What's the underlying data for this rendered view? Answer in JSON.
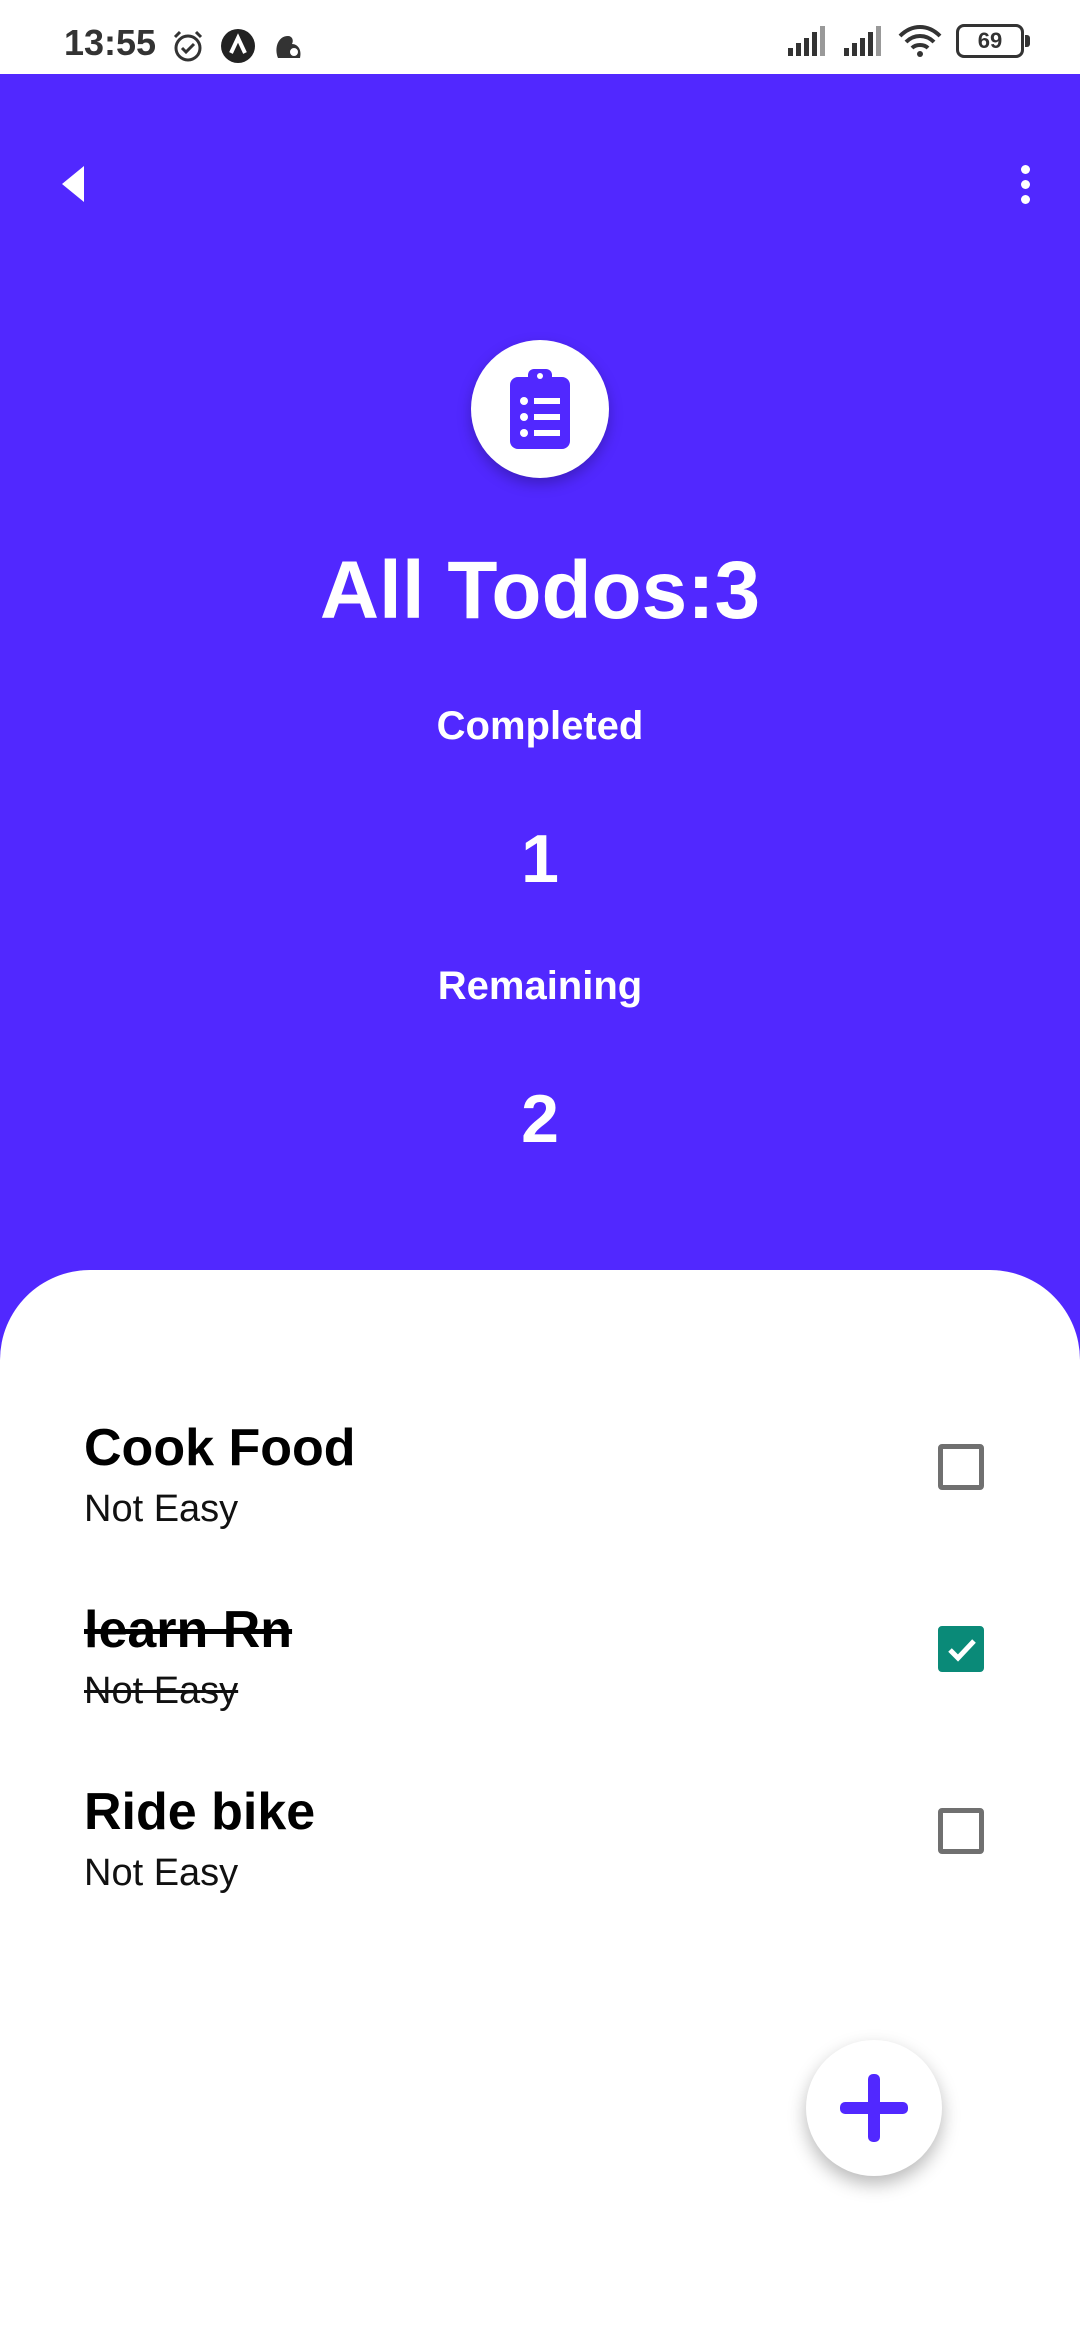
{
  "status_bar": {
    "time": "13:55",
    "battery": "69",
    "icons": [
      "alarm-icon",
      "app-icon",
      "squirrel-icon",
      "signal-icon",
      "signal-icon",
      "wifi-icon",
      "battery-icon"
    ]
  },
  "header": {
    "back_icon": "back-icon",
    "menu_icon": "more-vert-icon",
    "summary_icon": "clipboard-icon",
    "title": "All Todos:3",
    "completed_label": "Completed",
    "completed_count": "1",
    "remaining_label": "Remaining",
    "remaining_count": "2",
    "accent_color": "#5128FF"
  },
  "todos": [
    {
      "title": "Cook Food",
      "subtitle": "Not Easy",
      "checked": false
    },
    {
      "title": "learn Rn",
      "subtitle": "Not Easy",
      "checked": true
    },
    {
      "title": "Ride bike",
      "subtitle": "Not Easy",
      "checked": false
    }
  ],
  "checkbox_color": "#0A8A78",
  "fab": {
    "icon": "plus-icon"
  }
}
